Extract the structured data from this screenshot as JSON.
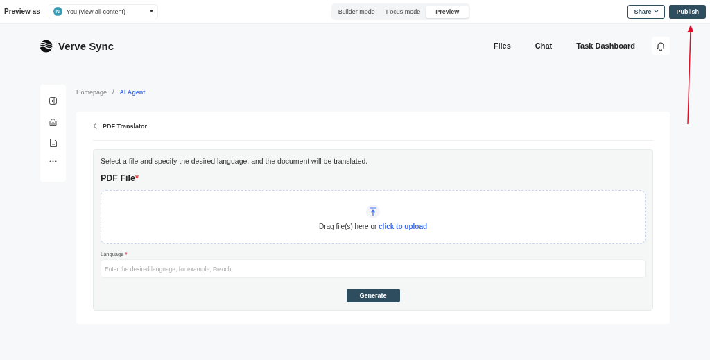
{
  "topbar": {
    "preview_label": "Preview as",
    "user_select": {
      "avatar": "N",
      "value": "You (view all content)"
    },
    "modes": [
      {
        "label": "Builder mode",
        "selected": false
      },
      {
        "label": "Focus mode",
        "selected": false
      },
      {
        "label": "Preview",
        "selected": true
      }
    ],
    "share": "Share",
    "publish": "Publish"
  },
  "header": {
    "brand": "Verve Sync",
    "nav": [
      "Files",
      "Chat",
      "Task Dashboard"
    ]
  },
  "breadcrumb": [
    {
      "label": "Homepage",
      "selected": false
    },
    {
      "label": "AI Agent",
      "selected": true
    }
  ],
  "breadcrumb_separator": "/",
  "page_title": "PDF Translator",
  "form": {
    "description": "Select a file and specify the desired language, and the document will be translated.",
    "file_label": "PDF File",
    "required_mark": "*",
    "upload_text": "Drag file(s) here or",
    "upload_link": "click to upload",
    "language_label": "Language",
    "language_placeholder": "Enter the desired language, for example, French.",
    "submit": "Generate"
  }
}
